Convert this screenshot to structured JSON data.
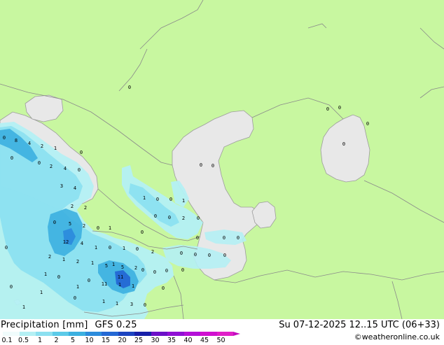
{
  "map": {
    "colors": {
      "land": "#c8f7a0",
      "sea": "#e8e8e8",
      "sea_edge": "#9c9c9c",
      "border": "#8a8a8a",
      "lake": "#a6e8f4"
    },
    "labels": [
      {
        "id": "p01",
        "text": "0"
      },
      {
        "id": "p02",
        "text": "8"
      },
      {
        "id": "p03",
        "text": "4"
      },
      {
        "id": "p04",
        "text": "2"
      },
      {
        "id": "p05",
        "text": "1"
      },
      {
        "id": "p06",
        "text": "0"
      },
      {
        "id": "p07",
        "text": "0"
      },
      {
        "id": "p08",
        "text": "2"
      },
      {
        "id": "p09",
        "text": "4"
      },
      {
        "id": "p10",
        "text": "0"
      },
      {
        "id": "p11",
        "text": "3"
      },
      {
        "id": "p12",
        "text": "4"
      },
      {
        "id": "p13",
        "text": "2"
      },
      {
        "id": "p14",
        "text": "2"
      },
      {
        "id": "p15",
        "text": "5"
      },
      {
        "id": "p16",
        "text": "2"
      },
      {
        "id": "p17",
        "text": "0"
      },
      {
        "id": "p18",
        "text": "1"
      },
      {
        "id": "p19",
        "text": "12"
      },
      {
        "id": "p20",
        "text": "4"
      },
      {
        "id": "p21",
        "text": "1"
      },
      {
        "id": "p22",
        "text": "0"
      },
      {
        "id": "p23",
        "text": "2"
      },
      {
        "id": "p24",
        "text": "1"
      },
      {
        "id": "p25",
        "text": "2"
      },
      {
        "id": "p26",
        "text": "1"
      },
      {
        "id": "p27",
        "text": "5"
      },
      {
        "id": "p28",
        "text": "5"
      },
      {
        "id": "p29",
        "text": "2"
      },
      {
        "id": "p30",
        "text": "11"
      },
      {
        "id": "p31",
        "text": "11"
      },
      {
        "id": "p32",
        "text": "1"
      },
      {
        "id": "p33",
        "text": "1"
      },
      {
        "id": "p34",
        "text": "1"
      },
      {
        "id": "p35",
        "text": "1"
      },
      {
        "id": "p36",
        "text": "3"
      },
      {
        "id": "p37",
        "text": "0"
      },
      {
        "id": "p38",
        "text": "2"
      },
      {
        "id": "p39",
        "text": "0"
      },
      {
        "id": "p40",
        "text": "1"
      },
      {
        "id": "p41",
        "text": "1"
      },
      {
        "id": "p42",
        "text": "0"
      },
      {
        "id": "p43",
        "text": "0"
      },
      {
        "id": "p44",
        "text": "1"
      },
      {
        "id": "p45",
        "text": "2"
      },
      {
        "id": "p46",
        "text": "0"
      },
      {
        "id": "p47",
        "text": "0"
      },
      {
        "id": "p48",
        "text": "0"
      },
      {
        "id": "p49",
        "text": "0"
      },
      {
        "id": "p50",
        "text": "0"
      },
      {
        "id": "p51",
        "text": "0"
      },
      {
        "id": "p52",
        "text": "0"
      },
      {
        "id": "p53",
        "text": "0"
      },
      {
        "id": "p54",
        "text": "0"
      },
      {
        "id": "p55",
        "text": "0"
      },
      {
        "id": "p56",
        "text": "0"
      },
      {
        "id": "p57",
        "text": "0"
      },
      {
        "id": "p58",
        "text": "0"
      },
      {
        "id": "p59",
        "text": "0"
      },
      {
        "id": "p60",
        "text": "0"
      },
      {
        "id": "p61",
        "text": "0"
      },
      {
        "id": "p62",
        "text": "0"
      },
      {
        "id": "p63",
        "text": "0"
      },
      {
        "id": "p64",
        "text": "0"
      },
      {
        "id": "p65",
        "text": "1"
      },
      {
        "id": "p66",
        "text": "0"
      },
      {
        "id": "p67",
        "text": "1"
      },
      {
        "id": "p68",
        "text": "0"
      },
      {
        "id": "p69",
        "text": "0"
      },
      {
        "id": "p70",
        "text": "1"
      },
      {
        "id": "p71",
        "text": "0"
      },
      {
        "id": "p72",
        "text": "1"
      },
      {
        "id": "p73",
        "text": "0"
      },
      {
        "id": "p74",
        "text": "0"
      },
      {
        "id": "p75",
        "text": "0"
      },
      {
        "id": "p76",
        "text": "1"
      },
      {
        "id": "p77",
        "text": "0"
      },
      {
        "id": "p78",
        "text": "0"
      },
      {
        "id": "p79",
        "text": "0"
      },
      {
        "id": "p80",
        "text": "0"
      }
    ]
  },
  "footer": {
    "title": "Precipitation [mm]",
    "model": "GFS 0.25",
    "valid_time": "Su 07-12-2025 12..15 UTC (06+33)",
    "credit": "©weatheronline.co.uk"
  },
  "legend": {
    "ticks": [
      "0.1",
      "0.5",
      "1",
      "2",
      "5",
      "10",
      "15",
      "20",
      "25",
      "30",
      "35",
      "40",
      "45",
      "50"
    ],
    "colors": [
      "#f0fcfc",
      "#b4f0f4",
      "#8ce0f0",
      "#5ccae8",
      "#3cb0e0",
      "#2c8cdc",
      "#2468d4",
      "#1c44c0",
      "#1820a8",
      "#6c10c8",
      "#9010d4",
      "#b410d8",
      "#d010d0",
      "#e020c8"
    ]
  }
}
